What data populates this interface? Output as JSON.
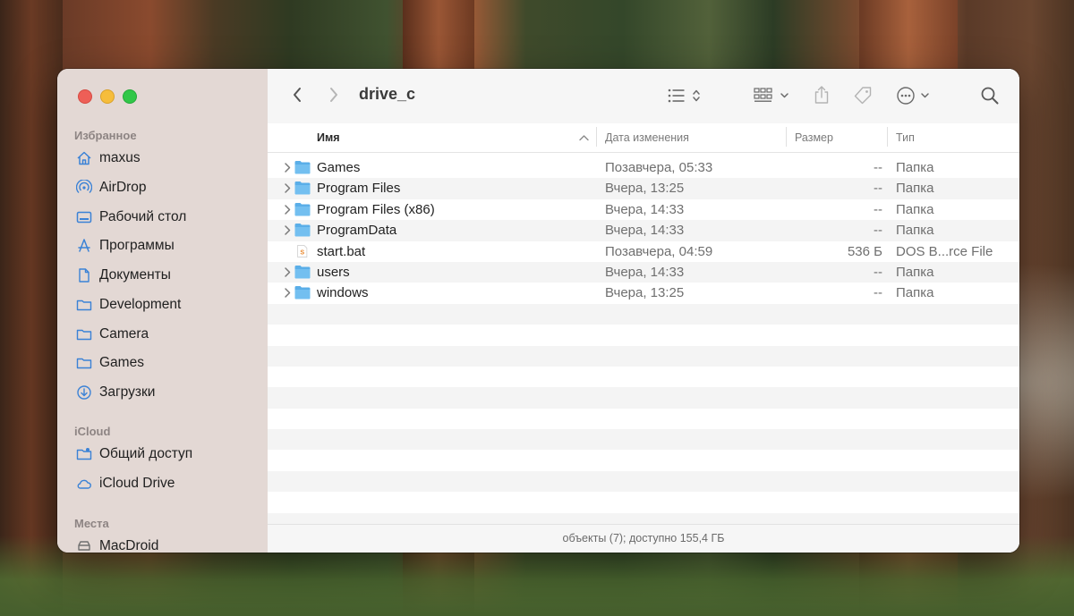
{
  "window": {
    "title": "drive_c"
  },
  "sidebar": {
    "sections": [
      {
        "label": "Избранное",
        "items": [
          {
            "label": "maxus",
            "icon": "home-icon"
          },
          {
            "label": "AirDrop",
            "icon": "airdrop-icon"
          },
          {
            "label": "Рабочий стол",
            "icon": "desktop-icon"
          },
          {
            "label": "Программы",
            "icon": "applications-icon"
          },
          {
            "label": "Документы",
            "icon": "document-icon"
          },
          {
            "label": "Development",
            "icon": "folder-icon"
          },
          {
            "label": "Camera",
            "icon": "folder-icon"
          },
          {
            "label": "Games",
            "icon": "folder-icon"
          },
          {
            "label": "Загрузки",
            "icon": "download-icon"
          }
        ]
      },
      {
        "label": "iCloud",
        "items": [
          {
            "label": "Общий доступ",
            "icon": "shared-folder-icon"
          },
          {
            "label": "iCloud Drive",
            "icon": "cloud-icon"
          }
        ]
      },
      {
        "label": "Места",
        "items": [
          {
            "label": "MacDroid",
            "icon": "drive-icon"
          }
        ]
      }
    ]
  },
  "columns": {
    "name": "Имя",
    "date": "Дата изменения",
    "size": "Размер",
    "kind": "Тип"
  },
  "files": [
    {
      "name": "Games",
      "date": "Позавчера, 05:33",
      "size": "--",
      "kind": "Папка",
      "type": "folder"
    },
    {
      "name": "Program Files",
      "date": "Вчера, 13:25",
      "size": "--",
      "kind": "Папка",
      "type": "folder"
    },
    {
      "name": "Program Files (x86)",
      "date": "Вчера, 14:33",
      "size": "--",
      "kind": "Папка",
      "type": "folder"
    },
    {
      "name": "ProgramData",
      "date": "Вчера, 14:33",
      "size": "--",
      "kind": "Папка",
      "type": "folder"
    },
    {
      "name": "start.bat",
      "date": "Позавчера, 04:59",
      "size": "536 Б",
      "kind": "DOS B...rce File",
      "type": "file"
    },
    {
      "name": "users",
      "date": "Вчера, 14:33",
      "size": "--",
      "kind": "Папка",
      "type": "folder"
    },
    {
      "name": "windows",
      "date": "Вчера, 13:25",
      "size": "--",
      "kind": "Папка",
      "type": "folder"
    }
  ],
  "status": {
    "text": "объекты (7); доступно 155,4 ГБ"
  },
  "colors": {
    "sidebar_bg": "#e3d8d4",
    "folder_blue": "#5aaee8",
    "accent": "#0a84ff"
  }
}
